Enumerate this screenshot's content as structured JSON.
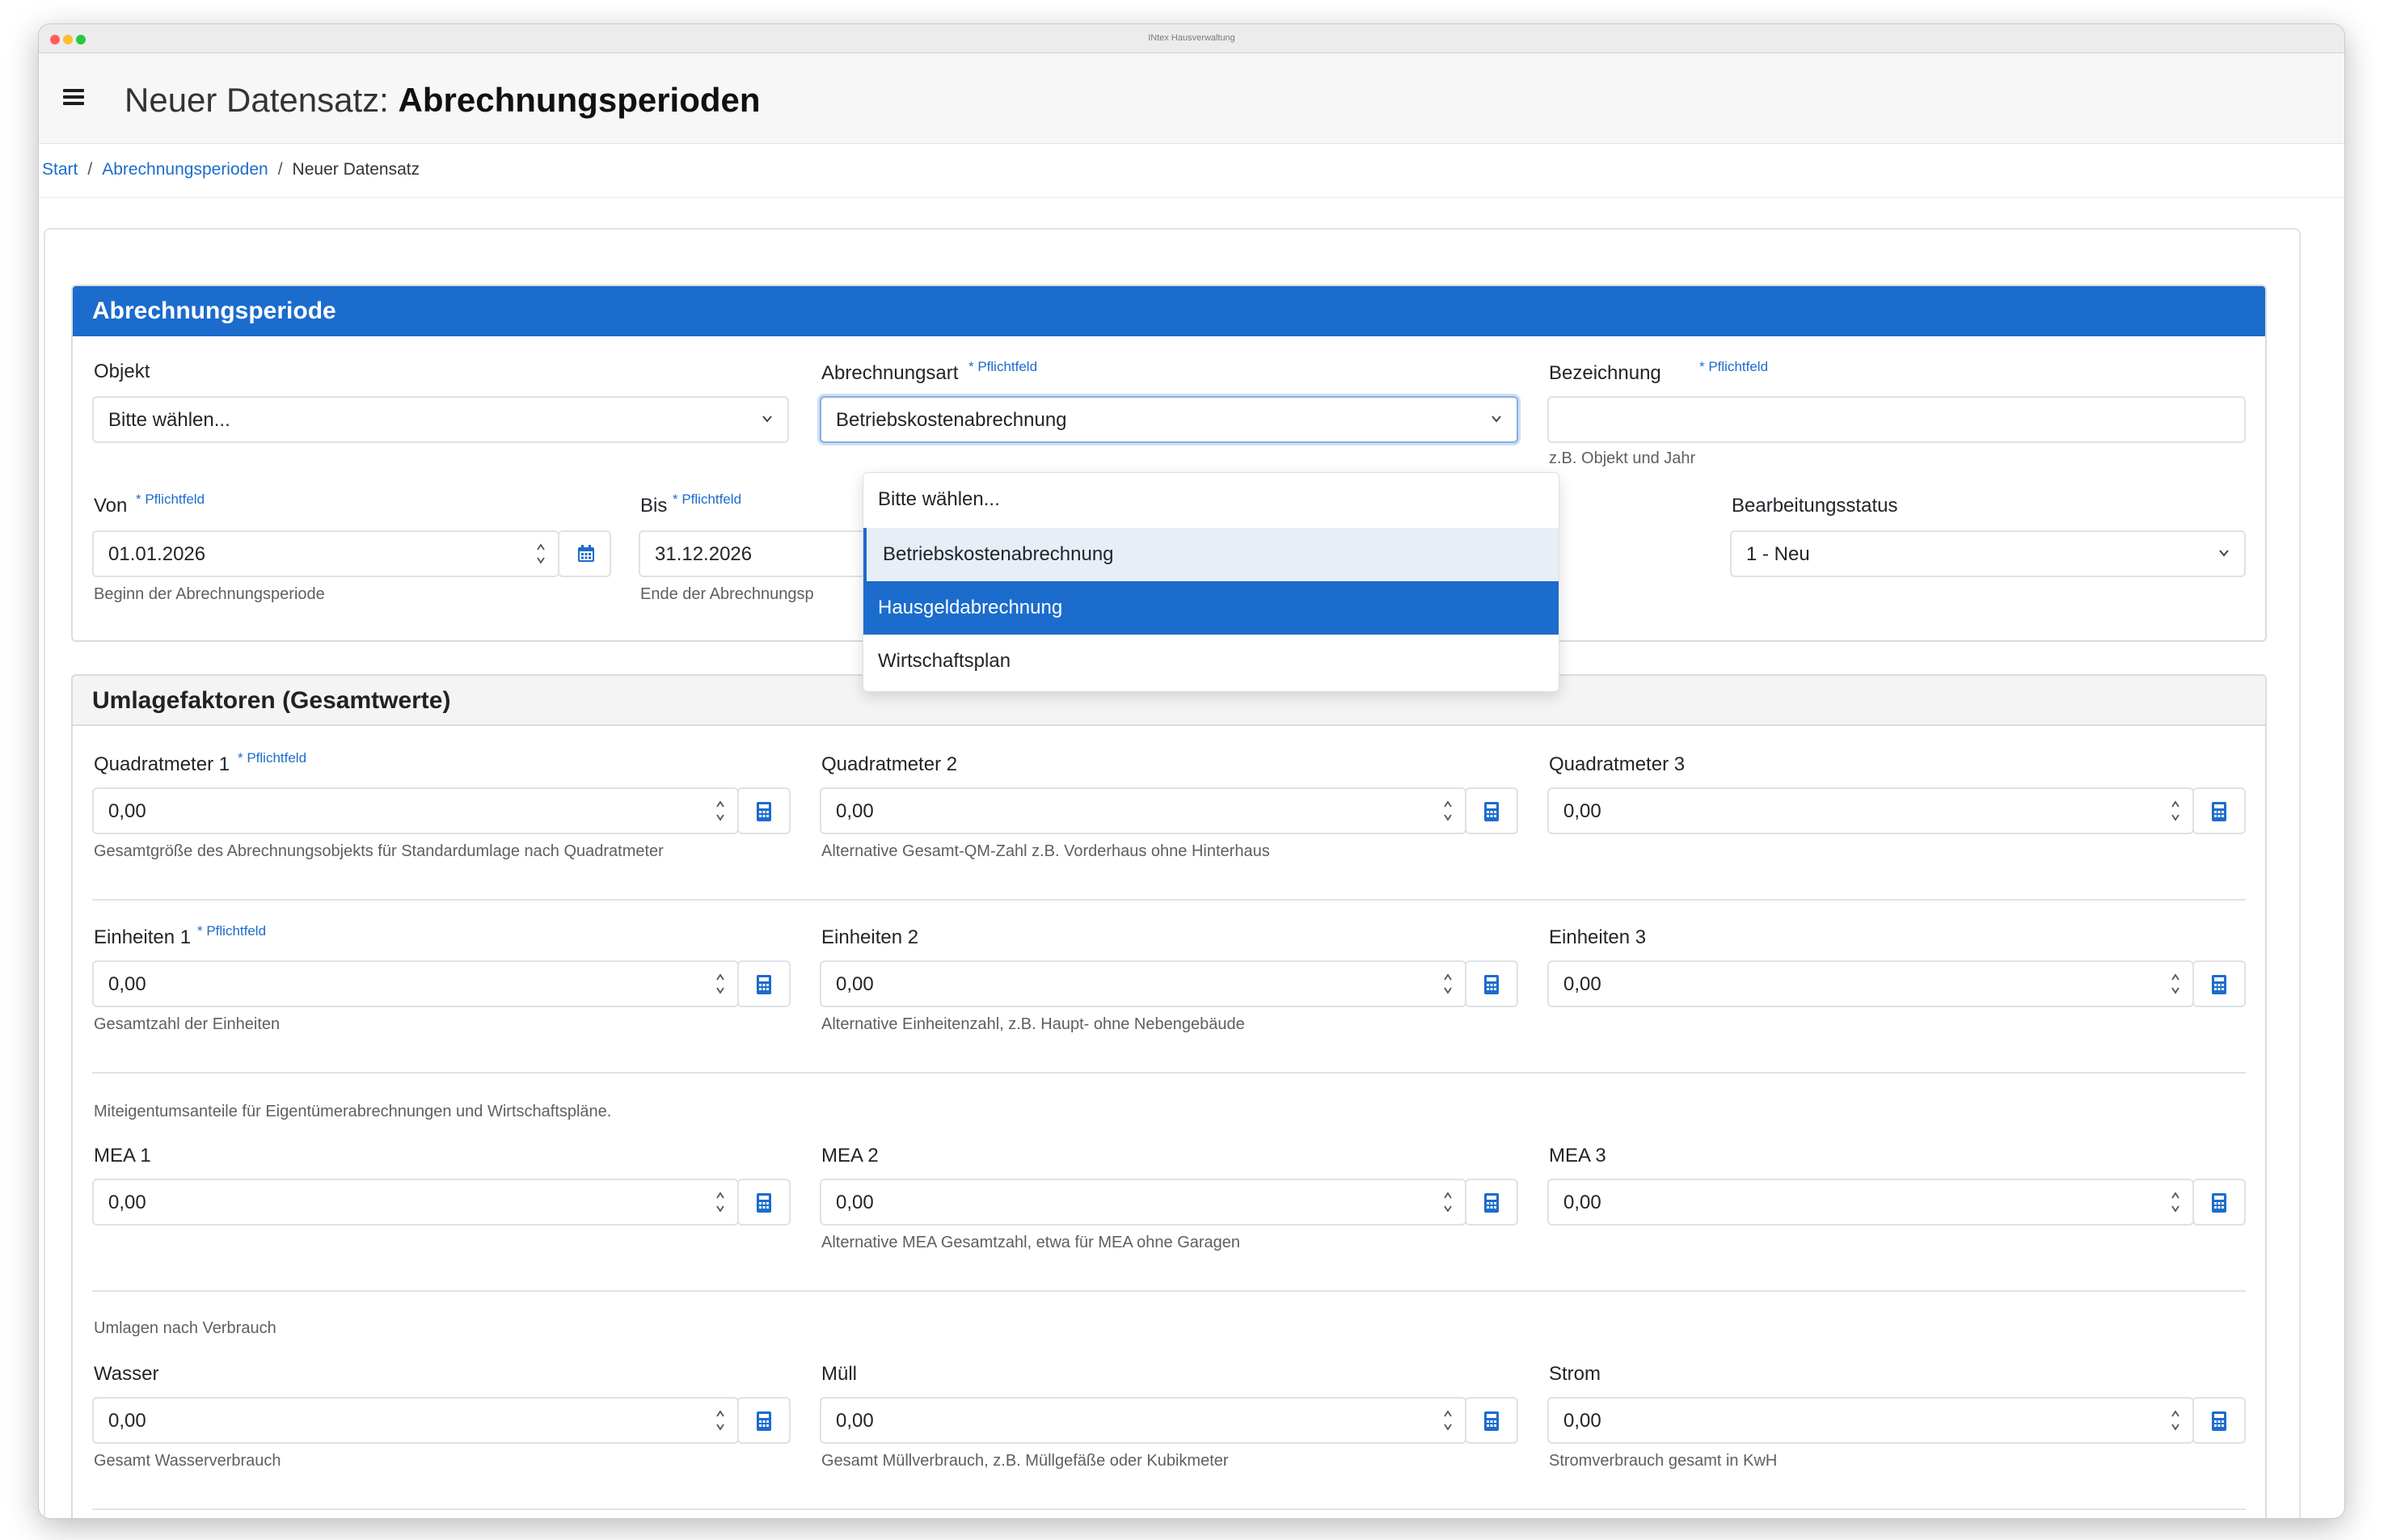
{
  "window": {
    "title": "INtex Hausverwaltung"
  },
  "header": {
    "title_prefix": "Neuer Datensatz:",
    "title_bold": "Abrechnungsperioden"
  },
  "breadcrumb": {
    "start": "Start",
    "list": "Abrechnungsperioden",
    "current": "Neuer Datensatz",
    "separator": "/"
  },
  "required_label": "* Pflichtfeld",
  "section1": {
    "title": "Abrechnungsperiode",
    "objekt": {
      "label": "Objekt",
      "value": "Bitte wählen..."
    },
    "abrechnungsart": {
      "label": "Abrechnungsart",
      "value": "Betriebskostenabrechnung",
      "options": [
        "Bitte wählen...",
        "Betriebskostenabrechnung",
        "Hausgeldabrechnung",
        "Wirtschaftsplan"
      ],
      "selected_option": "Betriebskostenabrechnung",
      "highlighted_option": "Hausgeldabrechnung"
    },
    "bezeichnung": {
      "label": "Bezeichnung",
      "value": "",
      "hint": "z.B. Objekt und Jahr"
    },
    "von": {
      "label": "Von",
      "value": "01.01.2026",
      "hint": "Beginn der Abrechnungsperiode"
    },
    "bis": {
      "label": "Bis",
      "value": "31.12.2026",
      "hint": "Ende der Abrechnungsp"
    },
    "status": {
      "label": "Bearbeitungsstatus",
      "value": "1 - Neu"
    }
  },
  "section2": {
    "title": "Umlagefaktoren (Gesamtwerte)",
    "qm1": {
      "label": "Quadratmeter 1",
      "value": "0,00",
      "hint": "Gesamtgröße des Abrechnungsobjekts für Standardumlage nach Quadratmeter"
    },
    "qm2": {
      "label": "Quadratmeter 2",
      "value": "0,00",
      "hint": "Alternative Gesamt-QM-Zahl z.B. Vorderhaus ohne Hinterhaus"
    },
    "qm3": {
      "label": "Quadratmeter 3",
      "value": "0,00"
    },
    "ein1": {
      "label": "Einheiten 1",
      "value": "0,00",
      "hint": "Gesamtzahl der Einheiten"
    },
    "ein2": {
      "label": "Einheiten 2",
      "value": "0,00",
      "hint": "Alternative Einheitenzahl, z.B. Haupt- ohne Nebengebäude"
    },
    "ein3": {
      "label": "Einheiten 3",
      "value": "0,00"
    },
    "mea_note": "Miteigentumsanteile für Eigentümerabrechnungen und Wirtschaftspläne.",
    "mea1": {
      "label": "MEA 1",
      "value": "0,00"
    },
    "mea2": {
      "label": "MEA 2",
      "value": "0,00",
      "hint": "Alternative MEA Gesamtzahl, etwa für MEA ohne Garagen"
    },
    "mea3": {
      "label": "MEA 3",
      "value": "0,00"
    },
    "verbrauch_note": "Umlagen nach Verbrauch",
    "wasser": {
      "label": "Wasser",
      "value": "0,00",
      "hint": "Gesamt Wasserverbrauch"
    },
    "muell": {
      "label": "Müll",
      "value": "0,00",
      "hint": "Gesamt Müllverbrauch, z.B. Müllgefäße oder Kubikmeter"
    },
    "strom": {
      "label": "Strom",
      "value": "0,00",
      "hint": "Stromverbrauch gesamt in KwH"
    }
  },
  "colors": {
    "accent": "#1b6ccc",
    "selected_option_bg": "#e8eef7"
  },
  "icons": {
    "menu": "hamburger-icon",
    "calendar": "calendar-icon",
    "calculator": "calculator-icon",
    "chevron": "chevron-down-icon",
    "spinner": "spinner-arrows-icon"
  }
}
